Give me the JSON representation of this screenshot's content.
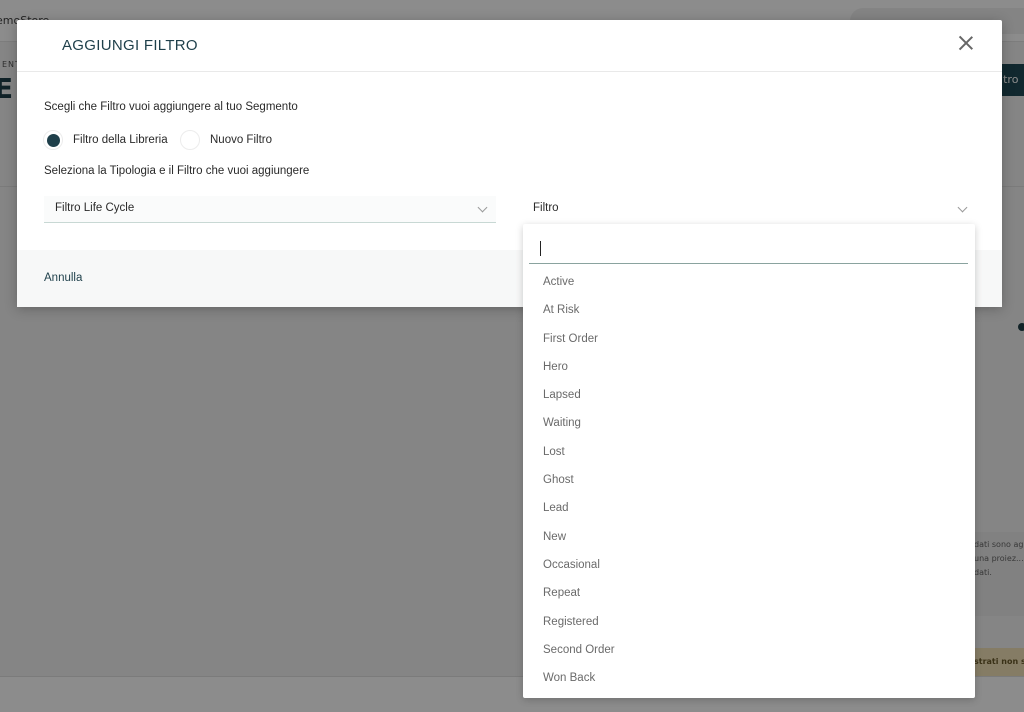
{
  "background": {
    "brand": "emoStore",
    "crumb": "ENT",
    "big_title": "E E",
    "top_button": "iltro",
    "note": "dati sono ag... una proiez... dati.",
    "warning": "strati non s"
  },
  "modal": {
    "title": "AGGIUNGI FILTRO",
    "question_segment": "Scegli che Filtro vuoi aggiungere al tuo Segmento",
    "radio_library": "Filtro della Libreria",
    "radio_new": "Nuovo Filtro",
    "question_type": "Seleziona la Tipologia e il Filtro che vuoi aggiungere",
    "type_select_value": "Filtro Life Cycle",
    "filter_select_value": "Filtro",
    "cancel": "Annulla"
  },
  "dropdown": {
    "search_value": "",
    "items": [
      "Active",
      "At Risk",
      "First Order",
      "Hero",
      "Lapsed",
      "Waiting",
      "Lost",
      "Ghost",
      "Lead",
      "New",
      "Occasional",
      "Repeat",
      "Registered",
      "Second Order",
      "Won Back"
    ]
  },
  "colors": {
    "accent": "#1e3f4a",
    "overlay": "rgba(0,0,0,0.45)"
  }
}
